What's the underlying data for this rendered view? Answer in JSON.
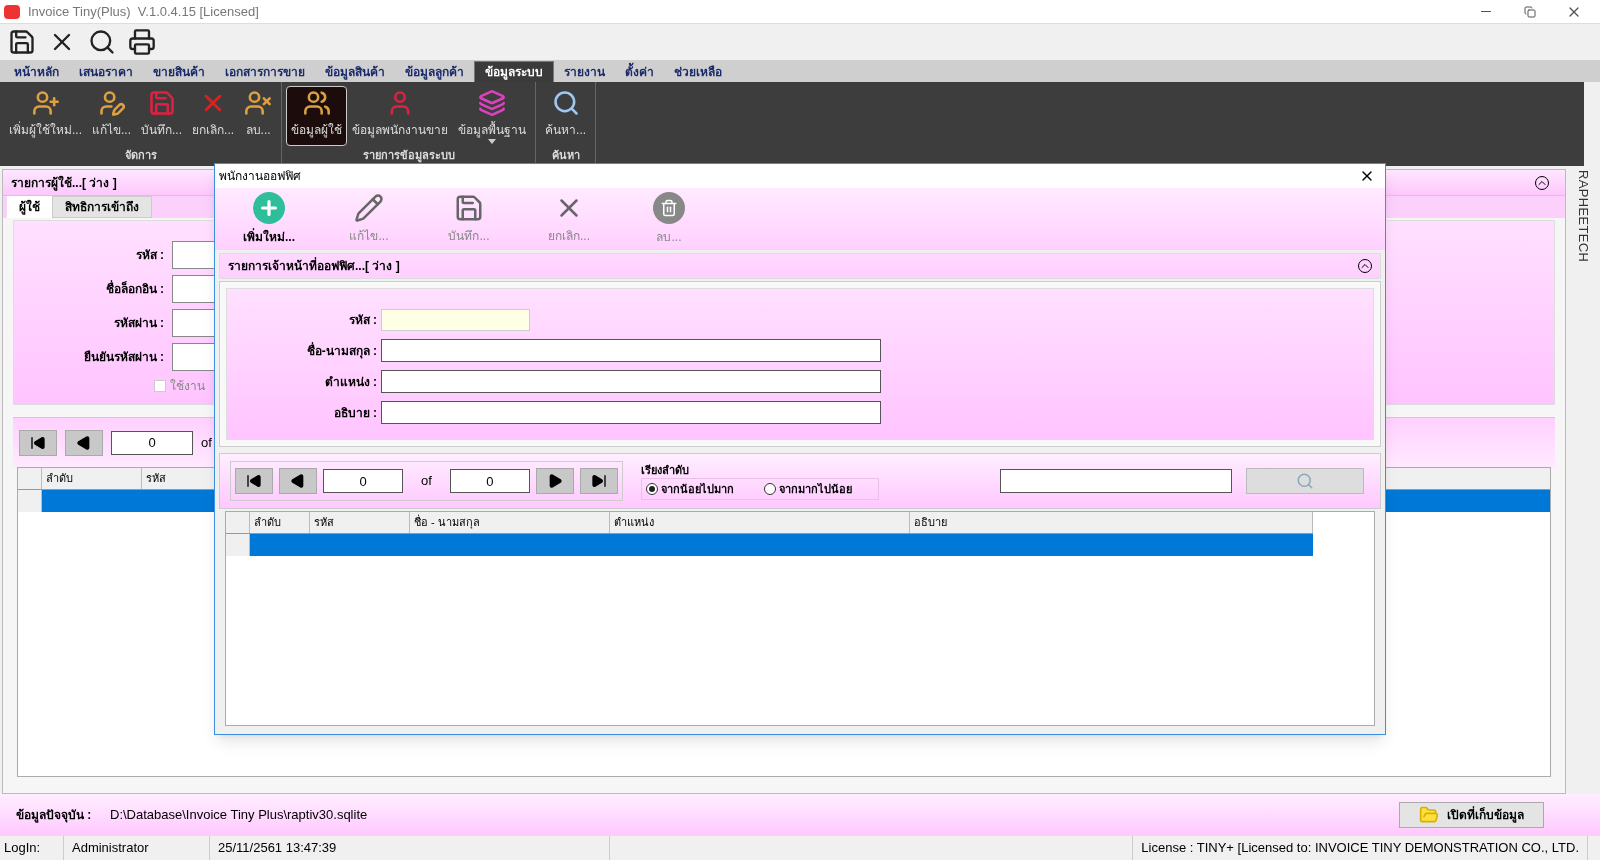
{
  "window": {
    "title": "Invoice Tiny(Plus)  V.1.0.4.15 [Licensed]"
  },
  "quick_toolbar": [
    {
      "kind": "save"
    },
    {
      "kind": "cancel"
    },
    {
      "kind": "search"
    },
    {
      "kind": "print"
    }
  ],
  "menu_tabs": [
    {
      "label": "หน้าหลัก",
      "selected": false
    },
    {
      "label": "เสนอราคา",
      "selected": false
    },
    {
      "label": "ขายสินค้า",
      "selected": false
    },
    {
      "label": "เอกสารการขาย",
      "selected": false
    },
    {
      "label": "ข้อมูลสินค้า",
      "selected": false
    },
    {
      "label": "ข้อมูลลูกค้า",
      "selected": false
    },
    {
      "label": "ข้อมูลระบบ",
      "selected": true
    },
    {
      "label": "รายงาน",
      "selected": false
    },
    {
      "label": "ตั้งค่า",
      "selected": false
    },
    {
      "label": "ช่วยเหลือ",
      "selected": false
    }
  ],
  "ribbon": [
    {
      "label": "จัดการ",
      "buttons": [
        {
          "label": "เพิ่มผู้ใช้ใหม่...",
          "kind": "add-user",
          "selected": false
        },
        {
          "label": "แก้ไข...",
          "kind": "edit-user",
          "selected": false
        },
        {
          "label": "บันทึก...",
          "kind": "save",
          "selected": false
        },
        {
          "label": "ยกเลิก...",
          "kind": "cancel",
          "selected": false
        },
        {
          "label": "ลบ...",
          "kind": "delete-user",
          "selected": false
        }
      ]
    },
    {
      "label": "รายการข้อมูลระบบ",
      "buttons": [
        {
          "label": "ข้อมูลผู้ใช้",
          "kind": "users",
          "selected": true
        },
        {
          "label": "ข้อมูลพนักงานขาย",
          "kind": "salesperson",
          "selected": false
        },
        {
          "label": "ข้อมูลพื้นฐาน",
          "kind": "layers",
          "selected": false,
          "dropdown": true
        }
      ]
    },
    {
      "label": "ค้นหา",
      "buttons": [
        {
          "label": "ค้นหา...",
          "kind": "search",
          "selected": false
        }
      ]
    }
  ],
  "user_panel": {
    "header": "รายการผู้ใช้...[ ว่าง ]",
    "tabs": [
      {
        "label": "ผู้ใช้",
        "selected": true
      },
      {
        "label": "สิทธิการเข้าถึง",
        "selected": false
      }
    ],
    "fields": [
      {
        "label": "รหัส :"
      },
      {
        "label": "ชื่อล็อกอิน :"
      },
      {
        "label": "รหัสผ่าน :"
      },
      {
        "label": "ยืนยันรหัสผ่าน :"
      }
    ],
    "checkbox": {
      "label": "ใช้งาน",
      "checked": false
    },
    "pager": {
      "current": "0",
      "of": "of"
    },
    "table": {
      "columns": [
        "ลำดับ",
        "รหัส"
      ],
      "rows": [
        {
          "selected": true
        }
      ]
    }
  },
  "side_label": "RAPHEETECH",
  "footer": {
    "label": "ข้อมูลปัจจุบัน :",
    "path": "D:\\Database\\Invoice Tiny Plus\\raptiv30.sqlite",
    "button": "เปิดที่เก็บข้อมูล"
  },
  "status_bar": [
    "LogIn:",
    "Administrator",
    "25/11/2561 13:47:39",
    "License : TINY+ [Licensed to: INVOICE TINY DEMONSTRATION CO., LTD."
  ],
  "dialog": {
    "title": "พนักงานออฟฟิศ",
    "toolbar": [
      {
        "label": "เพิ่มใหม่...",
        "kind": "add",
        "disabled": false
      },
      {
        "label": "แก้ไข...",
        "kind": "edit",
        "disabled": true
      },
      {
        "label": "บันทึก...",
        "kind": "save",
        "disabled": true
      },
      {
        "label": "ยกเลิก...",
        "kind": "cancel",
        "disabled": true
      },
      {
        "label": "ลบ...",
        "kind": "delete",
        "disabled": true
      }
    ],
    "header": "รายการเจ้าหน้าที่ออฟฟิศ...[ ว่าง ]",
    "fields": [
      {
        "label": "รหัส :",
        "kind": "code"
      },
      {
        "label": "ชื่อ-นามสกุล :",
        "kind": "text"
      },
      {
        "label": "ตำแหน่ง :",
        "kind": "text"
      },
      {
        "label": "อธิบาย :",
        "kind": "text"
      }
    ],
    "pager": {
      "current": "0",
      "of": "of",
      "total": "0"
    },
    "sort": {
      "label": "เรียงลำดับ",
      "options": [
        {
          "label": "จากน้อยไปมาก",
          "selected": true
        },
        {
          "label": "จากมากไปน้อย",
          "selected": false
        }
      ]
    },
    "table": {
      "columns": [
        "ลำดับ",
        "รหัส",
        "ชื่อ - นามสกุล",
        "ตำแหน่ง",
        "อธิบาย"
      ],
      "rows": [
        {
          "selected": true
        }
      ]
    }
  }
}
